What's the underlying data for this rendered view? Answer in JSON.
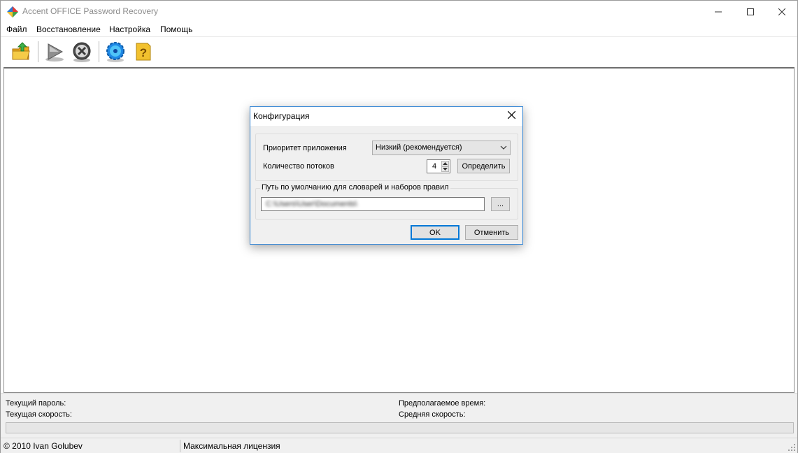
{
  "window": {
    "title": "Accent OFFICE Password Recovery",
    "controls": {
      "minimize": "—",
      "maximize": "☐",
      "close": "✕"
    }
  },
  "menu": {
    "items": [
      {
        "label": "Файл"
      },
      {
        "label": "Восстановление"
      },
      {
        "label": "Настройка"
      },
      {
        "label": "Помощь"
      }
    ]
  },
  "toolbar": {
    "buttons": [
      {
        "icon": "open-folder-icon"
      },
      {
        "icon": "play-icon"
      },
      {
        "icon": "stop-icon"
      },
      {
        "icon": "settings-gear-icon"
      },
      {
        "icon": "help-icon"
      }
    ]
  },
  "status_panel": {
    "current_password_label": "Текущий пароль:",
    "current_speed_label": "Текущая скорость:",
    "estimated_time_label": "Предполагаемое время:",
    "average_speed_label": "Средняя скорость:",
    "progress": 0
  },
  "statusbar": {
    "copyright": "© 2010 Ivan Golubev",
    "license": "Максимальная лицензия"
  },
  "dialog": {
    "title": "Конфигурация",
    "priority_label": "Приоритет приложения",
    "priority_value": "Низкий (рекомендуется)",
    "threads_label": "Количество потоков",
    "threads_value": "4",
    "detect_button": "Определить",
    "path_group_label": "Путь по умолчанию для словарей и наборов правил",
    "path_value": "C:\\Users\\User\\Documents\\",
    "browse_button": "...",
    "ok_button": "OK",
    "cancel_button": "Отменить"
  },
  "colors": {
    "accent_border": "#0078d7",
    "dialog_bg": "#f0f0f0",
    "button_bg": "#e1e1e1"
  }
}
